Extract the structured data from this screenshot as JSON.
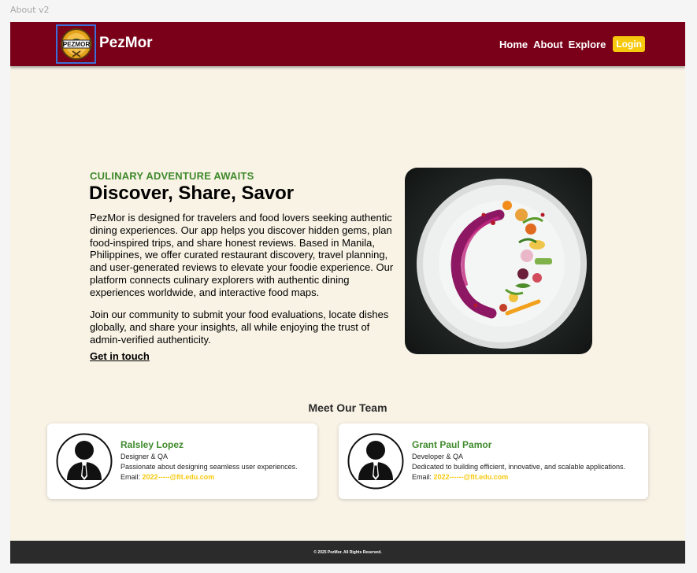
{
  "frame": {
    "label": "About v2"
  },
  "header": {
    "logo_text": "PEZMOR",
    "brand": "PezMor",
    "nav": [
      {
        "label": "Home"
      },
      {
        "label": "About"
      },
      {
        "label": "Explore"
      }
    ],
    "login_label": "Login"
  },
  "hero": {
    "eyebrow": "CULINARY ADVENTURE AWAITS",
    "title": "Discover, Share, Savor",
    "paragraph1": "PezMor is designed for travelers and food lovers seeking authentic dining experiences. Our app helps you discover hidden gems, plan food-inspired trips, and share honest reviews. Based in Manila, Philippines, we offer curated restaurant discovery, travel planning, and user-generated reviews to elevate your foodie experience. Our platform connects culinary explorers with authentic dining experiences worldwide, and interactive food maps.",
    "paragraph2": "Join our community to submit your food evaluations, locate dishes globally, and share your insights, all while enjoying the trust of admin-verified authenticity.",
    "cta_label": "Get in touch"
  },
  "team": {
    "heading": "Meet Our Team",
    "members": [
      {
        "name": "Ralsley Lopez",
        "role": "Designer & QA",
        "bio": "Passionate about designing seamless user experiences.",
        "email_label": "Email: ",
        "email": "2022-----@fit.edu.com"
      },
      {
        "name": "Grant Paul Pamor",
        "role": "Developer & QA",
        "bio": "Dedicated to building efficient, innovative, and scalable applications.",
        "email_label": "Email: ",
        "email": "2022------@fit.edu.com"
      }
    ]
  },
  "footer": {
    "text": "© 2025 PezMor. All Rights Reserved."
  },
  "colors": {
    "header_bg": "#7a0019",
    "page_bg": "#f9f3e6",
    "accent_green": "#3f8a2c",
    "accent_yellow": "#f6c90e",
    "footer_bg": "#2b2b2b",
    "selection_outline": "#3b6fd8"
  },
  "icons": {
    "logo": "pezmor-logo-icon",
    "avatar": "person-avatar-icon",
    "hero_image": "plated-dish-image"
  }
}
